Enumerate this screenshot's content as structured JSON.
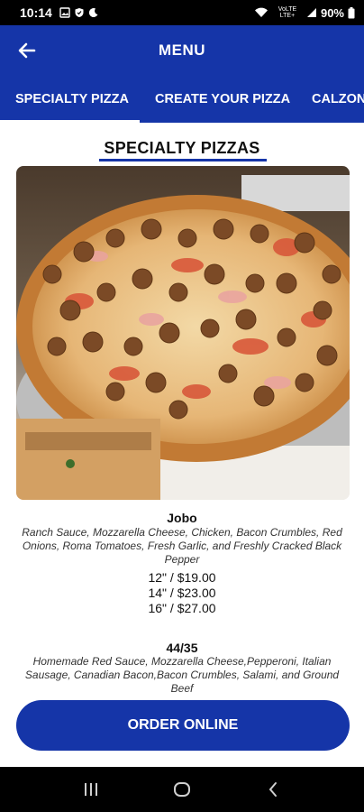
{
  "status_bar": {
    "time": "10:14",
    "battery": "90%",
    "network_label": "VoLTE LTE+"
  },
  "header": {
    "title": "MENU"
  },
  "tabs": [
    {
      "label": "SPECIALTY PIZZA",
      "active": true
    },
    {
      "label": "CREATE YOUR PIZZA",
      "active": false
    },
    {
      "label": "CALZONES",
      "active": false
    }
  ],
  "section": {
    "title": "SPECIALTY PIZZAS"
  },
  "items": [
    {
      "name": "Jobo",
      "description": "Ranch Sauce, Mozzarella Cheese, Chicken, Bacon Crumbles, Red Onions, Roma Tomatoes, Fresh Garlic, and Freshly Cracked Black Pepper",
      "prices": [
        "12\" / $19.00",
        "14\" / $23.00",
        "16\" / $27.00"
      ]
    },
    {
      "name": "44/35",
      "description": "Homemade Red Sauce, Mozzarella Cheese,Pepperoni, Italian Sausage, Canadian Bacon,Bacon Crumbles, Salami, and Ground Beef",
      "prices": []
    }
  ],
  "order_button": {
    "label": "ORDER ONLINE"
  },
  "colors": {
    "brand_blue": "#1535a8",
    "status_bar": "#000000"
  },
  "icons": {
    "back": "arrow-left-icon",
    "recents": "recents-icon",
    "home": "home-icon",
    "nav_back": "chevron-left-icon"
  }
}
